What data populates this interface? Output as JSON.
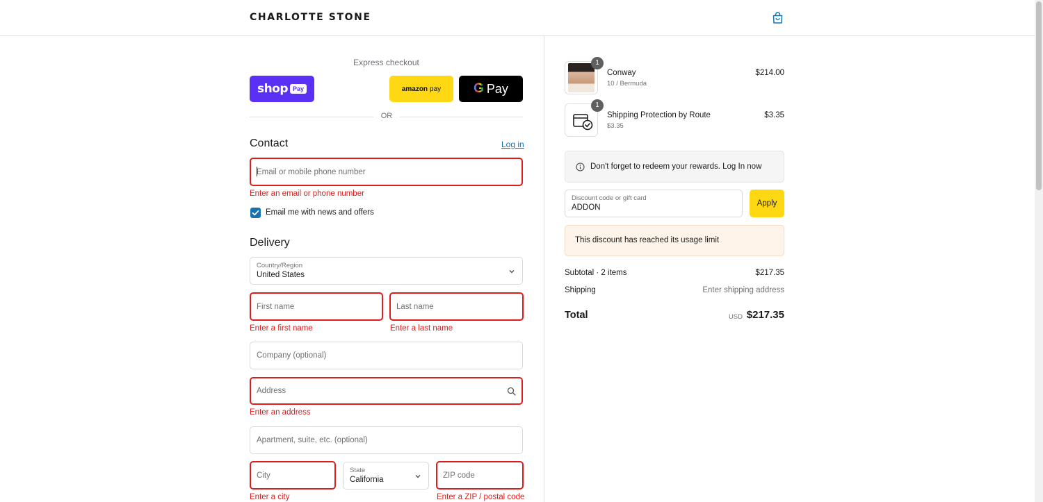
{
  "header": {
    "brand": "CHARLOTTE STONE",
    "cart_icon": "shopping-bag-icon"
  },
  "express": {
    "label": "Express checkout",
    "shop_pay": {
      "main": "shop",
      "tag": "Pay"
    },
    "amazon_pay": {
      "main": "amazon",
      "sub": "pay"
    },
    "google_pay": {
      "g": "G",
      "main": "Pay"
    },
    "or": "OR"
  },
  "contact": {
    "title": "Contact",
    "login": "Log in",
    "email_placeholder": "Email or mobile phone number",
    "email_error": "Enter an email or phone number",
    "newsletter_label": "Email me with news and offers",
    "newsletter_checked": true
  },
  "delivery": {
    "title": "Delivery",
    "country_label": "Country/Region",
    "country_value": "United States",
    "first_name_placeholder": "First name",
    "first_name_error": "Enter a first name",
    "last_name_placeholder": "Last name",
    "last_name_error": "Enter a last name",
    "company_placeholder": "Company (optional)",
    "address_placeholder": "Address",
    "address_error": "Enter an address",
    "apartment_placeholder": "Apartment, suite, etc. (optional)",
    "city_placeholder": "City",
    "city_error": "Enter a city",
    "state_label": "State",
    "state_value": "California",
    "zip_placeholder": "ZIP code",
    "zip_error": "Enter a ZIP / postal code"
  },
  "order": {
    "items": [
      {
        "qty": "1",
        "name": "Conway",
        "variant": "10 / Bermuda",
        "price": "$214.00"
      },
      {
        "qty": "1",
        "name": "Shipping Protection by Route",
        "variant": "$3.35",
        "price": "$3.35"
      }
    ],
    "rewards_text": "Don't forget to redeem your rewards. Log In now",
    "discount_label": "Discount code or gift card",
    "discount_value": "ADDON",
    "apply_label": "Apply",
    "discount_message": "This discount has reached its usage limit",
    "subtotal_label": "Subtotal · 2 items",
    "subtotal_value": "$217.35",
    "shipping_label": "Shipping",
    "shipping_value": "Enter shipping address",
    "total_label": "Total",
    "total_currency": "USD",
    "total_value": "$217.35"
  },
  "colors": {
    "accent": "#1773b0",
    "error": "#dd1d1d",
    "shop_pay": "#5a31f4",
    "amazon": "#ffd814",
    "alert_bg": "#fff4ea"
  }
}
